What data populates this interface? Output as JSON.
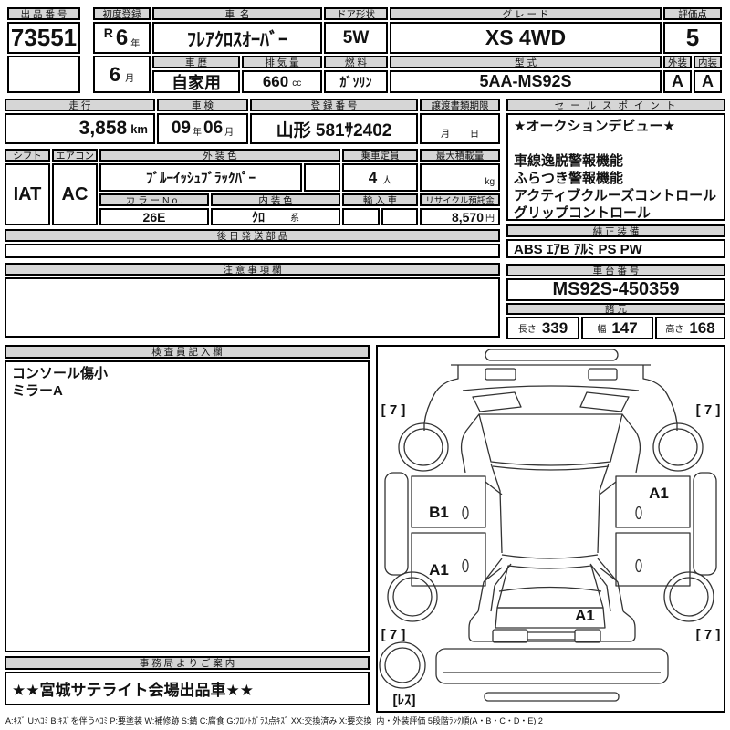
{
  "colors": {
    "header_bg": "#d6d6d6",
    "border": "#000000",
    "text": "#111111"
  },
  "top": {
    "auction_no": {
      "label": "出 品 番 号",
      "value": "73551"
    },
    "first_reg": {
      "label": "初度登録",
      "era": "R",
      "year": "6",
      "year_unit": "年",
      "month": "6",
      "month_unit": "月"
    },
    "car_name": {
      "label": "車  名",
      "value": "ﾌﾚｱｸﾛｽｵｰﾊﾞｰ"
    },
    "door": {
      "label": "ドア形状",
      "value": "5W"
    },
    "grade": {
      "label": "グ レ ー ド",
      "value": "XS 4WD"
    },
    "score": {
      "label": "評価点",
      "value": "5"
    },
    "history": {
      "label": "車 歴",
      "value": "自家用"
    },
    "displacement": {
      "label": "排 気 量",
      "value": "660",
      "unit": "cc"
    },
    "fuel": {
      "label": "燃 料",
      "value": "ｶﾞｿﾘﾝ"
    },
    "model": {
      "label": "型 式",
      "value": "5AA-MS92S"
    },
    "exterior": {
      "label": "外装",
      "value": "A"
    },
    "interior": {
      "label": "内装",
      "value": "A"
    }
  },
  "row2": {
    "mileage": {
      "label": "走 行",
      "value": "3,858",
      "unit": "km"
    },
    "inspection": {
      "label": "車 検",
      "year": "09",
      "year_unit": "年",
      "month": "06",
      "month_unit": "月"
    },
    "reg_no": {
      "label": "登 録 番 号",
      "value": "山形 581ｻ2402"
    },
    "transfer": {
      "label": "譲渡書類期限",
      "month_unit": "月",
      "day_unit": "日"
    }
  },
  "row3": {
    "shift": {
      "label": "シフト",
      "value": "IAT"
    },
    "aircon": {
      "label": "エアコン",
      "value": "AC"
    },
    "ext_color": {
      "label": "外 装 色",
      "value": "ﾌﾞﾙｰｲｯｼｭﾌﾞﾗｯｸﾊﾟｰ"
    },
    "capacity": {
      "label": "乗車定員",
      "value": "4",
      "unit": "人"
    },
    "max_load": {
      "label": "最大積載量",
      "unit": "kg"
    },
    "color_no": {
      "label": "カ ラ ー N o .",
      "value": "26E"
    },
    "int_color": {
      "label": "内 装 色",
      "value": "ｸﾛ",
      "unit": "系"
    },
    "import_car": {
      "label": "輸 入 車"
    },
    "recycle": {
      "label": "リサイクル預託金",
      "value": "8,570",
      "unit": "円"
    }
  },
  "later_parts": {
    "label": "後 日 発 送 部 品"
  },
  "notes": {
    "label": "注 意 事 項 欄"
  },
  "sales": {
    "label": "セ ー ル ス ポ イ ン ト",
    "lines": [
      "★オークションデビュー★",
      "",
      "車線逸脱警報機能",
      "ふらつき警報機能",
      "アクティブクルーズコントロール",
      "グリップコントロール"
    ]
  },
  "equipment": {
    "label": "純 正 装 備",
    "value": "ABS ｴｱB ｱﾙﾐ PS PW"
  },
  "chassis": {
    "label": "車 台 番 号",
    "value": "MS92S-450359"
  },
  "dims": {
    "label": "諸 元",
    "items": [
      {
        "k": "長さ",
        "v": "339"
      },
      {
        "k": "幅",
        "v": "147"
      },
      {
        "k": "高さ",
        "v": "168"
      }
    ]
  },
  "inspector": {
    "label": "検 査 員 記 入 欄",
    "lines": [
      "コンソール傷小",
      "ミラーA"
    ]
  },
  "office": {
    "label": "事 務 局 よ り ご 案 内",
    "value": "★★宮城サテライト会場出品車★★"
  },
  "diagram": {
    "tire_fl": "[ 7 ]",
    "tire_fr": "[ 7 ]",
    "tire_rl": "[ 7 ]",
    "tire_rr": "[ 7 ]",
    "door_lf": "B1",
    "door_lr": "A1",
    "door_rf": "A1",
    "rear_gate": "A1",
    "spare": "[ﾚｽ]"
  },
  "legend": "A:ｷｽﾞ U:ﾍｺﾐ B:ｷｽﾞを伴うﾍｺﾐ P:要塗装 W:補修跡 S:錆 C:腐食 G:ﾌﾛﾝﾄｶﾞﾗｽ点ｷｽﾞ XX:交換済み X:要交換  内・外装評価 5段階ﾗﾝｸ順(A・B・C・D・E) 2"
}
